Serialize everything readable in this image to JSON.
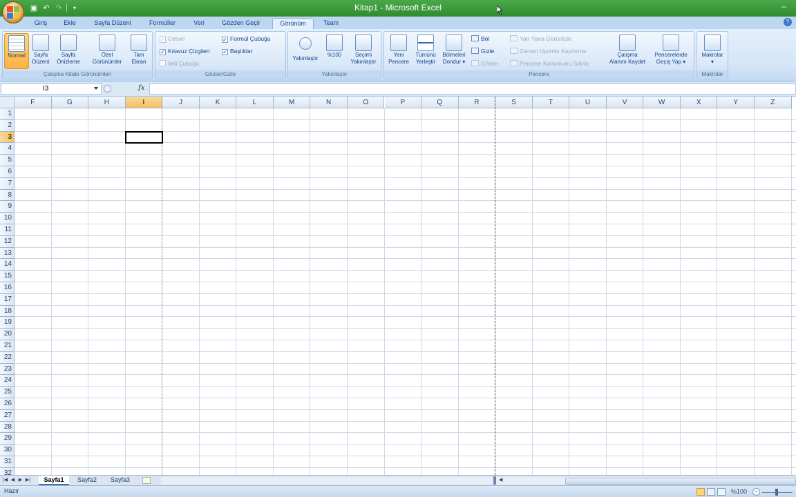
{
  "window": {
    "title": "Kitap1 - Microsoft Excel"
  },
  "tabs": [
    {
      "label": "Giriş"
    },
    {
      "label": "Ekle"
    },
    {
      "label": "Sayfa Düzeni"
    },
    {
      "label": "Formüller"
    },
    {
      "label": "Veri"
    },
    {
      "label": "Gözden Geçir"
    },
    {
      "label": "Görünüm"
    },
    {
      "label": "Team"
    }
  ],
  "active_tab": "Görünüm",
  "ribbon": {
    "workbook_views": {
      "label": "Çalışma Kitabı Görünümleri",
      "normal": "Normal",
      "page_layout_1": "Sayfa",
      "page_layout_2": "Düzeni",
      "page_break_1": "Sayfa",
      "page_break_2": "Önizleme",
      "custom_1": "Özel",
      "custom_2": "Görünümler",
      "full_1": "Tam",
      "full_2": "Ekran"
    },
    "show_hide": {
      "label": "Göster/Gizle",
      "ruler": "Cetvel",
      "gridlines": "Kılavuz Çizgileri",
      "message_bar": "İleti Çubuğu",
      "formula_bar": "Formül Çubuğu",
      "headings": "Başlıklar",
      "check": "✓"
    },
    "zoom": {
      "label": "Yakınlaştır",
      "zoom": "Yakınlaştır",
      "zoom100": "%100",
      "zoom_sel_1": "Seçimi",
      "zoom_sel_2": "Yakınlaştır"
    },
    "window": {
      "label": "Pencere",
      "new_1": "Yeni",
      "new_2": "Pencere",
      "arrange_1": "Tümünü",
      "arrange_2": "Yerleştir",
      "freeze_1": "Bölmeleri",
      "freeze_2": "Dondur",
      "split": "Böl",
      "hide": "Gizle",
      "unhide": "Göster",
      "side_by_side": "Yan Yana Görüntüle",
      "sync_scroll": "Zaman Uyumlu Kaydırma",
      "reset_pos": "Pencere Konumunu Sıfırla",
      "save_ws_1": "Çalışma",
      "save_ws_2": "Alanını Kaydet",
      "switch_1": "Pencerelerde",
      "switch_2": "Geçiş Yap"
    },
    "macros": {
      "label": "Makrolar",
      "macros": "Makrolar"
    }
  },
  "formula_bar": {
    "name_box": "I3",
    "fx": "fx",
    "value": ""
  },
  "columns": [
    "F",
    "G",
    "H",
    "I",
    "J",
    "K",
    "L",
    "M",
    "N",
    "O",
    "P",
    "Q",
    "R",
    "S",
    "T",
    "U",
    "V",
    "W",
    "X",
    "Y",
    "Z"
  ],
  "rows": [
    "1",
    "2",
    "3",
    "4",
    "5",
    "6",
    "7",
    "8",
    "9",
    "10",
    "11",
    "12",
    "13",
    "14",
    "15",
    "16",
    "17",
    "18",
    "19",
    "20",
    "21",
    "22",
    "23",
    "24",
    "25",
    "26",
    "27",
    "28",
    "29",
    "30",
    "31",
    "32"
  ],
  "selected_cell": {
    "column": "I",
    "row": "3"
  },
  "sheets": [
    {
      "label": "Sayfa1"
    },
    {
      "label": "Sayfa2"
    },
    {
      "label": "Sayfa3"
    }
  ],
  "active_sheet": "Sayfa1",
  "status": {
    "text": "Hazır",
    "zoom": "%100"
  }
}
